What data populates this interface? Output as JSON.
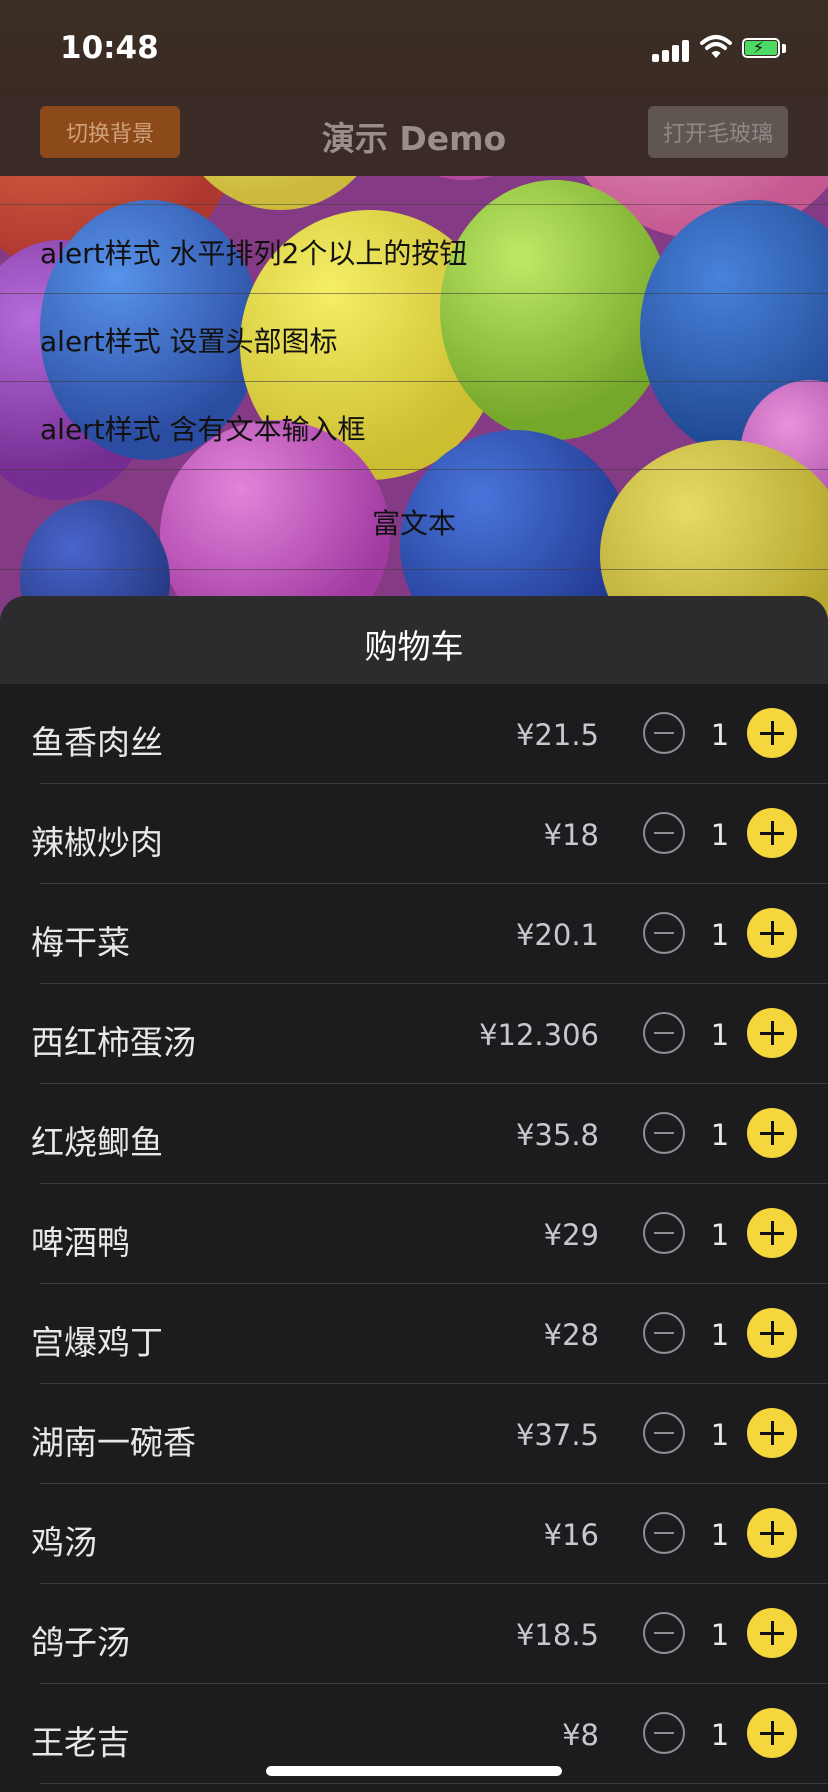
{
  "status_bar": {
    "time": "10:48"
  },
  "nav": {
    "title": "演示 Demo",
    "left_button": "切换背景",
    "right_button": "打开毛玻璃"
  },
  "menu": {
    "items": [
      {
        "label": "alert样式 水平排列2个以上的按钮"
      },
      {
        "label": "alert样式 设置头部图标"
      },
      {
        "label": "alert样式 含有文本输入框"
      },
      {
        "label": "富文本"
      }
    ]
  },
  "cart": {
    "title": "购物车",
    "items": [
      {
        "name": "鱼香肉丝",
        "price": "¥21.5",
        "qty": "1"
      },
      {
        "name": "辣椒炒肉",
        "price": "¥18",
        "qty": "1"
      },
      {
        "name": "梅干菜",
        "price": "¥20.1",
        "qty": "1"
      },
      {
        "name": "西红柿蛋汤",
        "price": "¥12.306",
        "qty": "1"
      },
      {
        "name": "红烧鲫鱼",
        "price": "¥35.8",
        "qty": "1"
      },
      {
        "name": "啤酒鸭",
        "price": "¥29",
        "qty": "1"
      },
      {
        "name": "宫爆鸡丁",
        "price": "¥28",
        "qty": "1"
      },
      {
        "name": "湖南一碗香",
        "price": "¥37.5",
        "qty": "1"
      },
      {
        "name": "鸡汤",
        "price": "¥16",
        "qty": "1"
      },
      {
        "name": "鸽子汤",
        "price": "¥18.5",
        "qty": "1"
      },
      {
        "name": "王老吉",
        "price": "¥8",
        "qty": "1"
      }
    ]
  },
  "colors": {
    "accent_plus": "#f5d63d",
    "switch_button": "#8c4a1a",
    "sheet_bg": "#1c1c1e",
    "sheet_header_bg": "#2c2c2e"
  }
}
